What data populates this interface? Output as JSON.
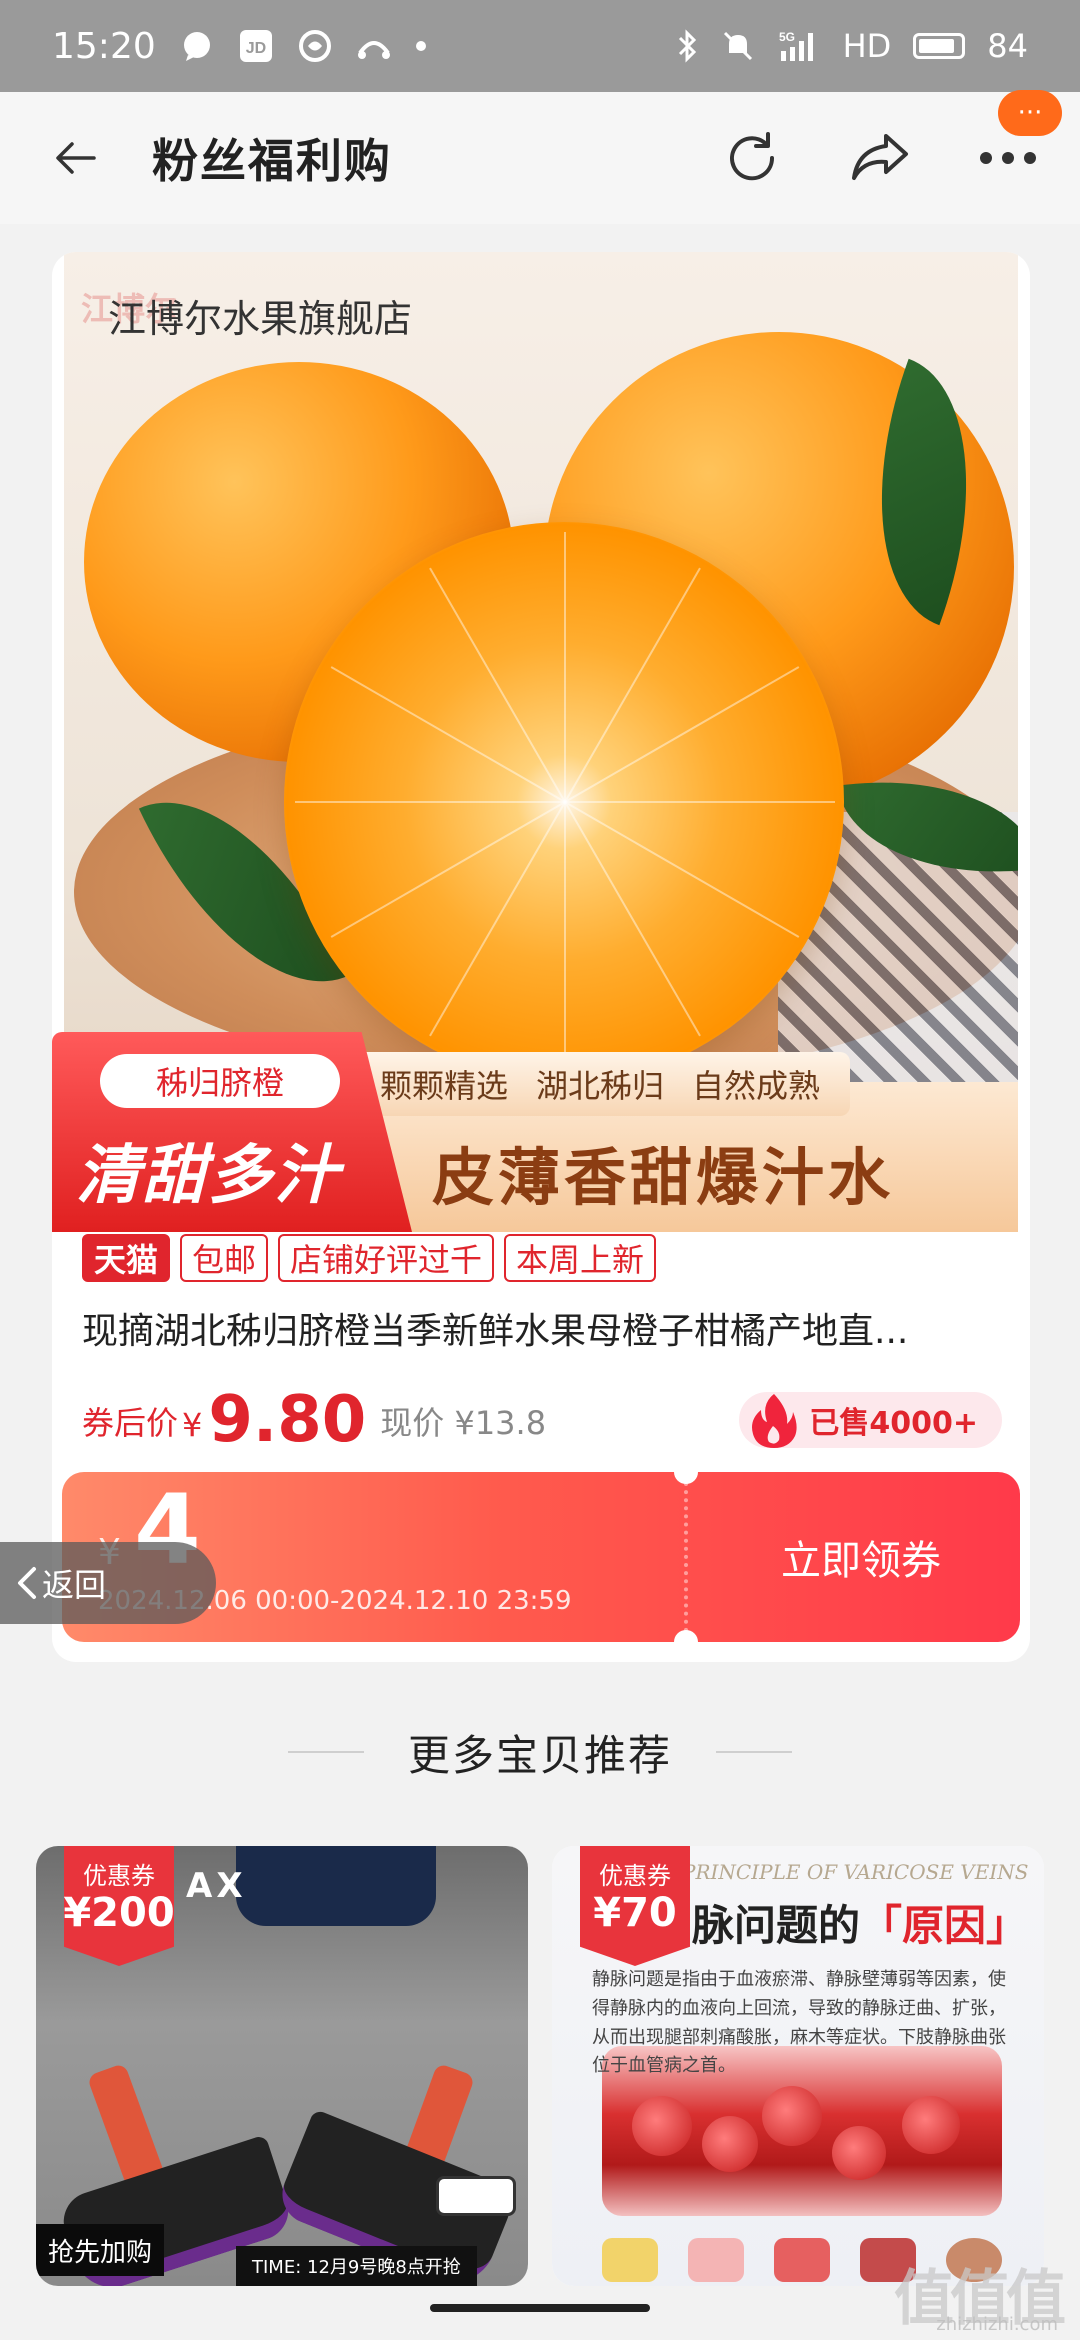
{
  "status_bar": {
    "time": "15:20",
    "signal": "5G",
    "hd": "HD",
    "battery": "84"
  },
  "nav": {
    "title": "粉丝福利购",
    "more_badge": "···"
  },
  "product": {
    "store_name": "江博尔水果旗舰店",
    "logo_text": "江博尔",
    "banner": {
      "tag": "秭归脐橙",
      "main": "清甜多汁",
      "chips": [
        "颗颗精选",
        "湖北秭归",
        "自然成熟"
      ],
      "slogan": "皮薄香甜爆汁水"
    },
    "tags": [
      "天猫",
      "包邮",
      "店铺好评过千",
      "本周上新"
    ],
    "title": "现摘湖北秭归脐橙当季新鲜水果母橙子柑橘产地直...",
    "price_label": "券后价",
    "currency": "¥",
    "price": "9.80",
    "original_price": "现价 ¥13.8",
    "sold": "已售4000+"
  },
  "coupon": {
    "currency": "¥",
    "amount": "4",
    "validity": "2024.12.06 00:00-2024.12.10 23:59",
    "button": "立即领券"
  },
  "return_button": "返回",
  "section_title": "更多宝贝推荐",
  "recommendations": [
    {
      "badge_label": "优惠券",
      "badge_amount": "¥200",
      "brand": "AX",
      "grab": "抢先加购",
      "time": "TIME: 12月9号晚8点开抢"
    },
    {
      "badge_label": "优惠券",
      "badge_amount": "¥70",
      "header": "PRINCIPLE OF VARICOSE VEINS",
      "title_prefix": "脉问题的",
      "title_highlight": "「原因」",
      "body": "静脉问题是指由于血液瘀滞、静脉壁薄弱等因素，使得静脉内的血液向上回流，导致的静脉迂曲、扩张，从而出现腿部刺痛酸胀，麻木等症状。下肢静脉曲张位于血管病之首。"
    }
  ],
  "watermark": {
    "main": "值值值",
    "sub": "zhizhizhi.com"
  }
}
